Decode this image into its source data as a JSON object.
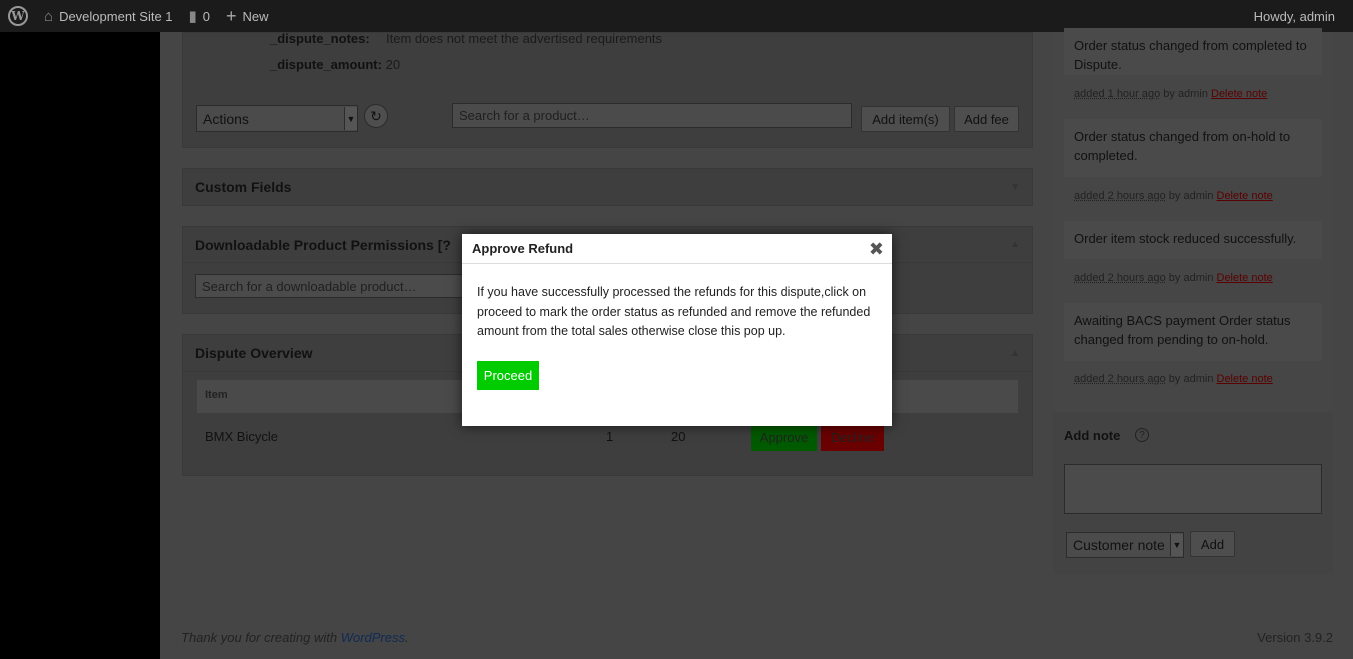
{
  "adminbar": {
    "site_name": "Development Site 1",
    "comments_count": "0",
    "new_label": "New",
    "howdy": "Howdy, admin"
  },
  "order_items": {
    "dispute_notes_label": "_dispute_notes:",
    "dispute_notes_value": "Item does not meet the advertised requirements",
    "dispute_amount_label": "_dispute_amount:",
    "dispute_amount_value": "20",
    "actions_select": "Actions",
    "product_search_placeholder": "Search for a product…",
    "add_items_label": "Add item(s)",
    "add_fee_label": "Add fee"
  },
  "custom_fields": {
    "title": "Custom Fields"
  },
  "downloadable": {
    "title": "Downloadable Product Permissions [?",
    "search_placeholder": "Search for a downloadable product…"
  },
  "dispute_overview": {
    "title": "Dispute Overview",
    "col_item": "Item",
    "row": {
      "item": "BMX Bicycle",
      "qty": "1",
      "amount": "20"
    },
    "approve_label": "Approve",
    "decline_label": "Decline"
  },
  "notes": [
    {
      "text": "Order status changed from completed to Dispute.",
      "ago": "added 1 hour ago",
      "by": " by admin ",
      "delete": "Delete note"
    },
    {
      "text": "Order status changed from on-hold to completed.",
      "ago": "added 2 hours ago",
      "by": " by admin ",
      "delete": "Delete note"
    },
    {
      "text": "Order item stock reduced successfully.",
      "ago": "added 2 hours ago",
      "by": " by admin ",
      "delete": "Delete note"
    },
    {
      "text": "Awaiting BACS payment Order status changed from pending to on-hold.",
      "ago": "added 2 hours ago",
      "by": " by admin ",
      "delete": "Delete note"
    }
  ],
  "add_note": {
    "title": "Add note",
    "type_select": "Customer note",
    "add_label": "Add"
  },
  "modal": {
    "title": "Approve Refund",
    "close_glyph": "✖",
    "body": "If you have successfully processed the refunds for this dispute,click on proceed to mark the order status as refunded and remove the refunded amount from the total sales otherwise close this pop up.",
    "proceed_label": "Proceed"
  },
  "footer": {
    "thanks": "Thank you for creating with ",
    "wp_link": "WordPress",
    "period": ".",
    "version": "Version 3.9.2"
  },
  "colors": {
    "proceed_bg": "#00cc00",
    "approve_bg": "#005a00",
    "decline_bg": "#6a0000"
  }
}
